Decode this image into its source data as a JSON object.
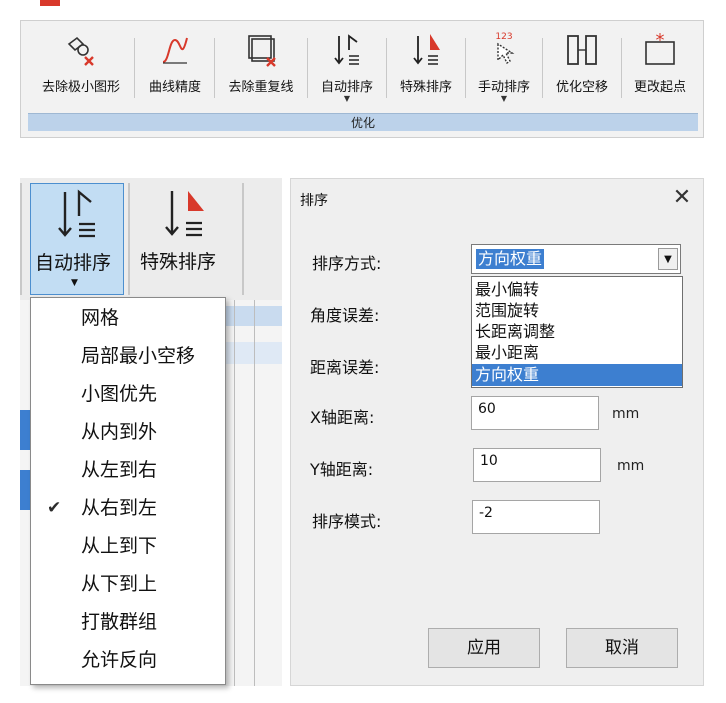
{
  "ribbon": {
    "buttons": [
      {
        "label": "去除极小图形",
        "icon": "remove-small-shapes-icon"
      },
      {
        "label": "曲线精度",
        "icon": "curve-precision-icon"
      },
      {
        "label": "去除重复线",
        "icon": "remove-duplicate-lines-icon"
      },
      {
        "label": "自动排序",
        "icon": "auto-sort-icon"
      },
      {
        "label": "特殊排序",
        "icon": "special-sort-icon"
      },
      {
        "label": "手动排序",
        "icon": "manual-sort-icon"
      },
      {
        "label": "优化空移",
        "icon": "optimize-move-icon"
      },
      {
        "label": "更改起点",
        "icon": "change-start-icon"
      }
    ],
    "manual_sort_digits": "123",
    "group_label": "优化"
  },
  "left_panel": {
    "auto_sort_label": "自动排序",
    "special_sort_label": "特殊排序",
    "menu": {
      "items": [
        {
          "label": "网格",
          "checked": false
        },
        {
          "label": "局部最小空移",
          "checked": false
        },
        {
          "label": "小图优先",
          "checked": false
        },
        {
          "label": "从内到外",
          "checked": false
        },
        {
          "label": "从左到右",
          "checked": false
        },
        {
          "label": "从右到左",
          "checked": true
        },
        {
          "label": "从上到下",
          "checked": false
        },
        {
          "label": "从下到上",
          "checked": false
        },
        {
          "label": "打散群组",
          "checked": false
        },
        {
          "label": "允许反向",
          "checked": false
        }
      ],
      "check_mark": "✔"
    }
  },
  "dialog": {
    "title": "排序",
    "close_glyph": "✕",
    "sort_method_label": "排序方式:",
    "sort_method_value": "方向权重",
    "sort_method_options": [
      "最小偏转",
      "范围旋转",
      "长距离调整",
      "最小距离",
      "方向权重"
    ],
    "selected_option": "方向权重",
    "angle_error_label": "角度误差:",
    "distance_error_label": "距离误差:",
    "x_distance_label": "X轴距离:",
    "x_distance_value": "60",
    "x_unit": "mm",
    "y_distance_label": "Y轴距离:",
    "y_distance_value": "10",
    "y_unit": "mm",
    "sort_mode_label": "排序模式:",
    "sort_mode_value": "-2",
    "apply_label": "应用",
    "cancel_label": "取消",
    "combo_arrow": "▼"
  },
  "colors": {
    "accent": "#3d7fd0",
    "group_bar": "#bcd2ea",
    "active_button": "#c2ddf3",
    "icon_red": "#d8392b"
  }
}
